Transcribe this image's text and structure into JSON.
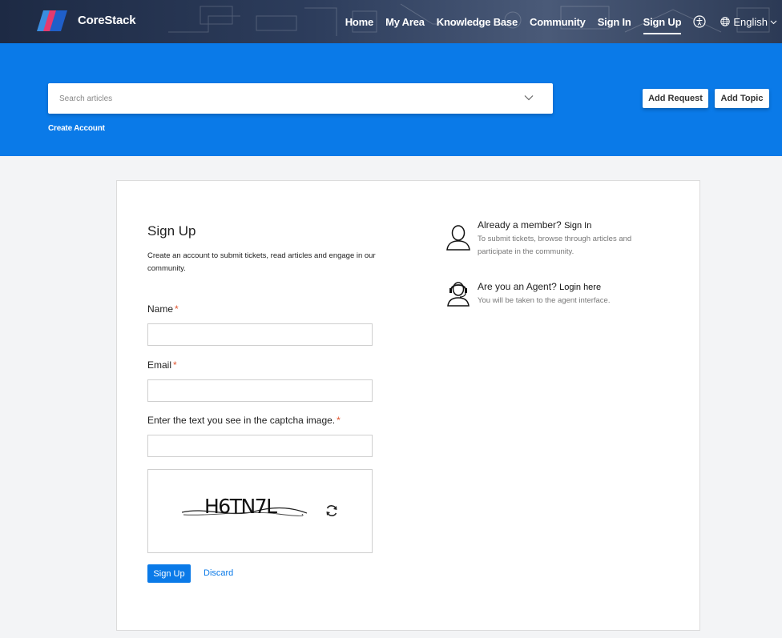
{
  "brand": {
    "name": "CoreStack"
  },
  "nav": {
    "links": [
      "Home",
      "My Area",
      "Knowledge Base",
      "Community",
      "Sign In",
      "Sign Up"
    ],
    "active": "Sign Up",
    "language": "English",
    "icons": [
      "accessibility-icon",
      "globe-icon",
      "chevron-down-icon"
    ]
  },
  "banner": {
    "search_placeholder": "Search articles",
    "create_account": "Create Account",
    "add_request": "Add Request",
    "add_topic": "Add Topic",
    "accent_color": "#0a7ae8"
  },
  "form": {
    "title": "Sign Up",
    "subtitle": "Create an account to submit tickets, read articles and engage in our community.",
    "name_label": "Name",
    "email_label": "Email",
    "captcha_label": "Enter the text you see in the captcha image.",
    "required_marker": "*",
    "captcha_text": "H6TN7L",
    "submit_label": "Sign Up",
    "discard_label": "Discard"
  },
  "side": {
    "member_title": "Already a member?",
    "member_link": "Sign In",
    "member_desc": "To submit tickets, browse through articles and participate in the community.",
    "agent_title": "Are you an Agent?",
    "agent_link": "Login here",
    "agent_desc": "You will be taken to the agent interface."
  }
}
